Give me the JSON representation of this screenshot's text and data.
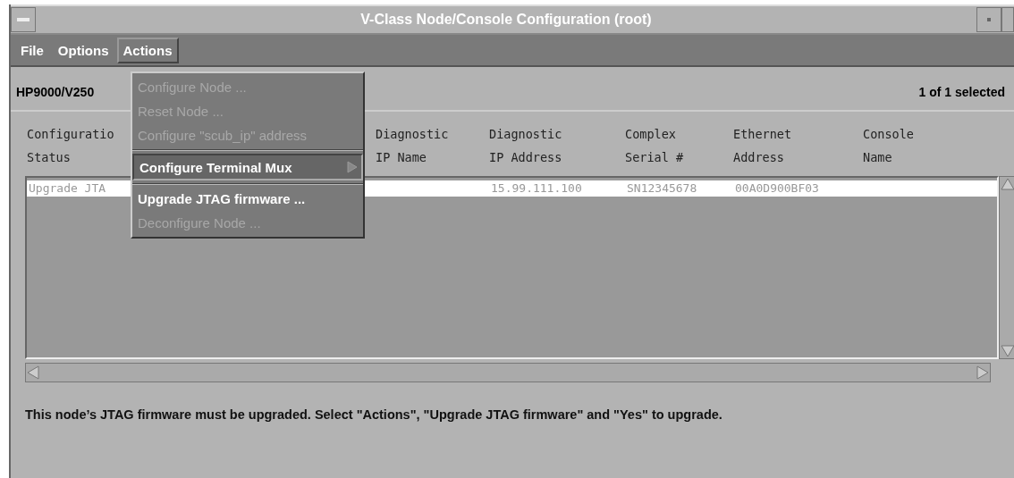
{
  "window": {
    "title": "V-Class Node/Console Configuration (root)"
  },
  "menubar": [
    {
      "label": "File",
      "selected": false
    },
    {
      "label": "Options",
      "selected": false
    },
    {
      "label": "Actions",
      "selected": true
    }
  ],
  "menu": [
    {
      "label": "Configure Node ...",
      "kind": "item",
      "disabled": true,
      "selected": false
    },
    {
      "label": "Reset Node ...",
      "kind": "item",
      "disabled": true,
      "selected": false
    },
    {
      "label": "Configure \"scub_ip\" address",
      "kind": "item",
      "disabled": true,
      "selected": false
    },
    {
      "label": "Configure Terminal Mux",
      "kind": "submenu",
      "disabled": false,
      "selected": true
    },
    {
      "label": "Upgrade JTAG firmware ...",
      "kind": "item",
      "disabled": false,
      "selected": false
    },
    {
      "label": "Deconfigure Node ...",
      "kind": "item",
      "disabled": true,
      "selected": false
    }
  ],
  "header": {
    "system": "HP9000/V250",
    "selection_count": "1 of 1 selected"
  },
  "table": {
    "columns": [
      [
        "Configuratio",
        "Status"
      ],
      [
        "Diagnostic",
        "IP Name"
      ],
      [
        "Diagnostic",
        "IP Address"
      ],
      [
        "Complex",
        "Serial #"
      ],
      [
        "Ethernet",
        "Address"
      ],
      [
        "Console",
        "Name"
      ]
    ],
    "rows": [
      {
        "selected": true,
        "status": "Upgrade JTA",
        "diagnostic_ip_address": "15.99.111.100",
        "complex_serial": "SN12345678",
        "ethernet_address": "00A0D900BF03"
      }
    ]
  },
  "message": "This node’s JTAG firmware must be upgraded. Select \"Actions\", \"Upgrade JTAG firmware\" and \"Yes\" to upgrade."
}
